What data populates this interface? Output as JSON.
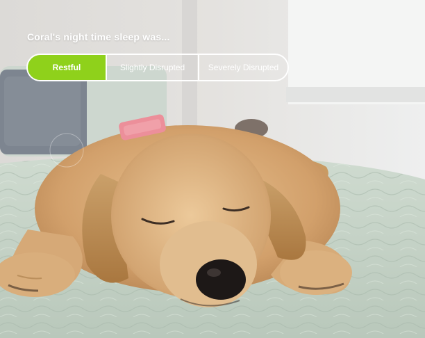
{
  "prompt": {
    "title": "Coral's night time sleep was..."
  },
  "options": [
    {
      "label": "Restful",
      "selected": true
    },
    {
      "label": "Slightly Disrupted",
      "selected": false
    },
    {
      "label": "Severely Disrupted",
      "selected": false
    }
  ],
  "photo": {
    "subject": "golden retriever puppy sleeping on a bed"
  },
  "colors": {
    "accent": "#8fd11b",
    "text": "#ffffff",
    "bedding": "#c9d6c8",
    "fur": "#d3a26c"
  }
}
